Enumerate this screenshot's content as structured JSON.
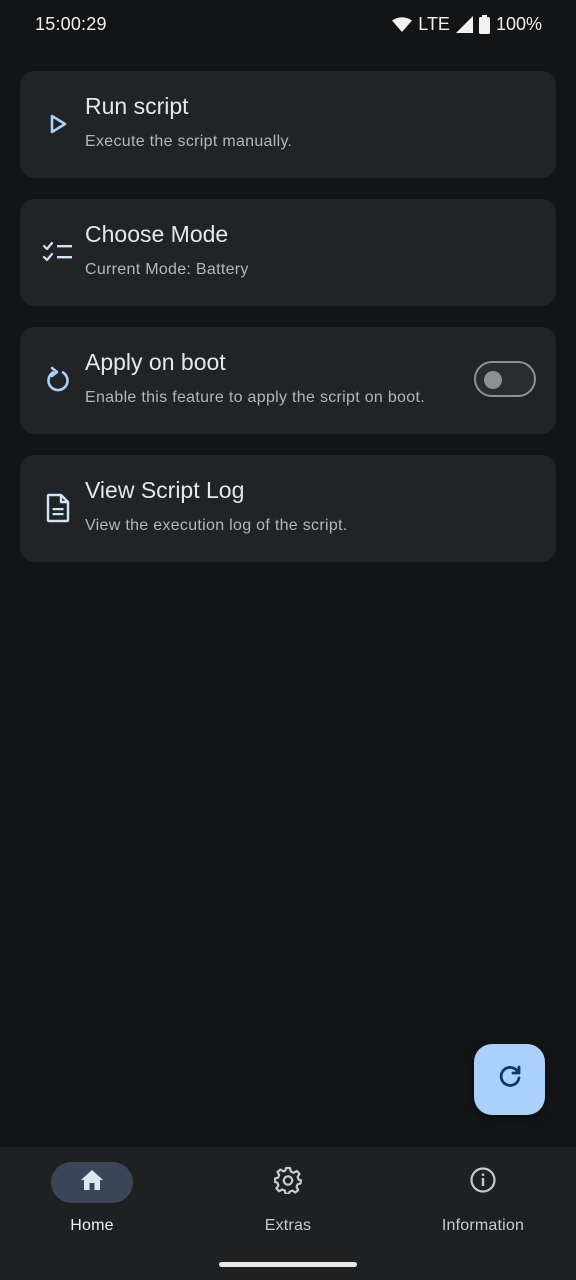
{
  "status_bar": {
    "time": "15:00:29",
    "network": "LTE",
    "battery": "100%"
  },
  "cards": [
    {
      "title": "Run script",
      "subtitle": "Execute the script manually.",
      "icon": "play-icon"
    },
    {
      "title": "Choose Mode",
      "subtitle": "Current Mode: Battery",
      "icon": "checklist-icon"
    },
    {
      "title": "Apply on boot",
      "subtitle": "Enable this feature to apply the script on boot.",
      "icon": "restart-icon",
      "toggle_on": false
    },
    {
      "title": "View Script Log",
      "subtitle": "View the execution log of the script.",
      "icon": "document-icon"
    }
  ],
  "fab": {
    "icon": "refresh-icon"
  },
  "bottom_nav": {
    "items": [
      {
        "label": "Home",
        "icon": "home-icon",
        "active": true
      },
      {
        "label": "Extras",
        "icon": "gear-icon",
        "active": false
      },
      {
        "label": "Information",
        "icon": "info-icon",
        "active": false
      }
    ]
  },
  "colors": {
    "background": "#131415",
    "card": "#212325",
    "accent": "#a9d1fb",
    "icon_tint": "#a9d1fb",
    "nav_active_pill": "#3a4655"
  }
}
